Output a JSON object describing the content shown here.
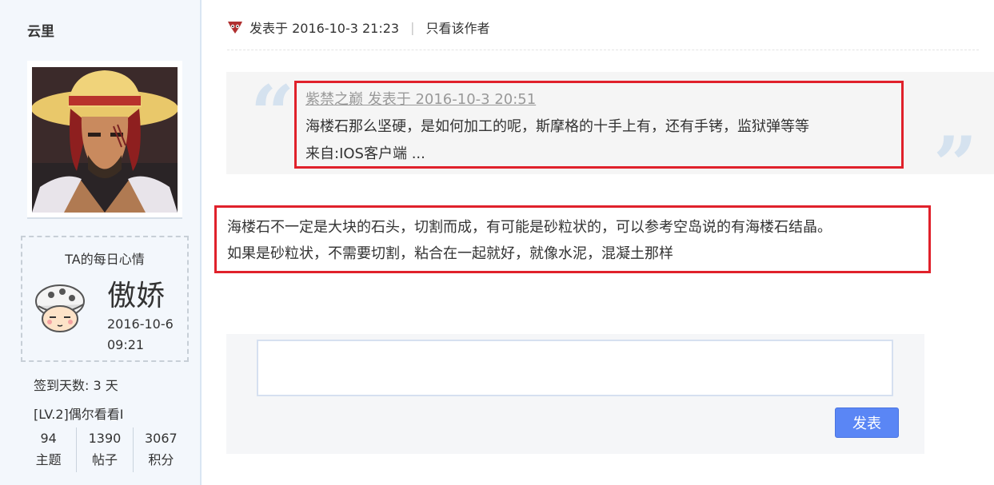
{
  "sidebar": {
    "username": "云里",
    "mood": {
      "title": "TA的每日心情",
      "word": "傲娇",
      "date": "2016-10-6",
      "time": "09:21"
    },
    "signin": "签到天数: 3 天",
    "level": "[LV.2]偶尔看看I",
    "stats": [
      {
        "value": "94",
        "label": "主题"
      },
      {
        "value": "1390",
        "label": "帖子"
      },
      {
        "value": "3067",
        "label": "积分"
      }
    ]
  },
  "post": {
    "posted_at": "发表于 2016-10-3 21:23",
    "author_only": "只看该作者",
    "quote": {
      "author_line": "紫禁之巅 发表于 2016-10-3 20:51",
      "line1": "海楼石那么坚硬，是如何加工的呢，斯摩格的十手上有，还有手铐，监狱弹等等",
      "line2": "来自:IOS客户端 ..."
    },
    "reply": {
      "line1": "海楼石不一定是大块的石头，切割而成，有可能是砂粒状的，可以参考空岛说的有海楼石结晶。",
      "line2": "如果是砂粒状，不需要切割，粘合在一起就好，就像水泥，混凝土那样"
    }
  },
  "reply_form": {
    "submit_label": "发表"
  },
  "colors": {
    "sidebar_bg": "#f3f7fc",
    "highlight_border": "#e0212b",
    "button_blue": "#5a86f5"
  }
}
